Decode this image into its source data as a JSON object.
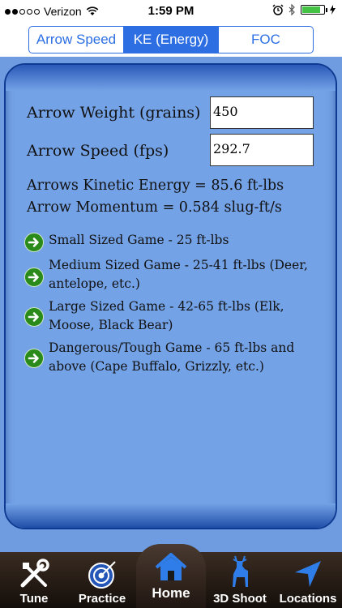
{
  "status_bar": {
    "carrier": "Verizon",
    "time": "1:59 PM"
  },
  "segments": [
    {
      "label": "Arrow Speed",
      "active": false
    },
    {
      "label": "KE (Energy)",
      "active": true
    },
    {
      "label": "FOC",
      "active": false
    }
  ],
  "form": {
    "weight_label": "Arrow Weight (grains)",
    "weight_value": "450",
    "speed_label": "Arrow Speed (fps)",
    "speed_value": "292.7"
  },
  "results": {
    "kinetic_energy": "Arrows Kinetic Energy = 85.6 ft-lbs",
    "momentum": "Arrow Momentum = 0.584 slug-ft/s"
  },
  "game_ranges": [
    {
      "text": "Small Sized Game - 25 ft-lbs"
    },
    {
      "text": "Medium Sized Game - 25-41 ft-lbs (Deer, antelope, etc.)"
    },
    {
      "text": "Large Sized Game - 42-65 ft-lbs (Elk, Moose, Black Bear)"
    },
    {
      "text": "Dangerous/Tough Game - 65 ft-lbs and above (Cape Buffalo, Grizzly, etc.)"
    }
  ],
  "tabs": [
    {
      "label": "Tune",
      "icon": "tools-icon"
    },
    {
      "label": "Practice",
      "icon": "target-icon"
    },
    {
      "label": "Home",
      "icon": "home-icon"
    },
    {
      "label": "3D Shoot",
      "icon": "deer-icon"
    },
    {
      "label": "Locations",
      "icon": "location-arrow-icon"
    }
  ],
  "colors": {
    "accent": "#2d6fe3",
    "background": "#6f9be0",
    "panel_border": "#0e3a92",
    "bullet_green": "#2a8a1a"
  }
}
